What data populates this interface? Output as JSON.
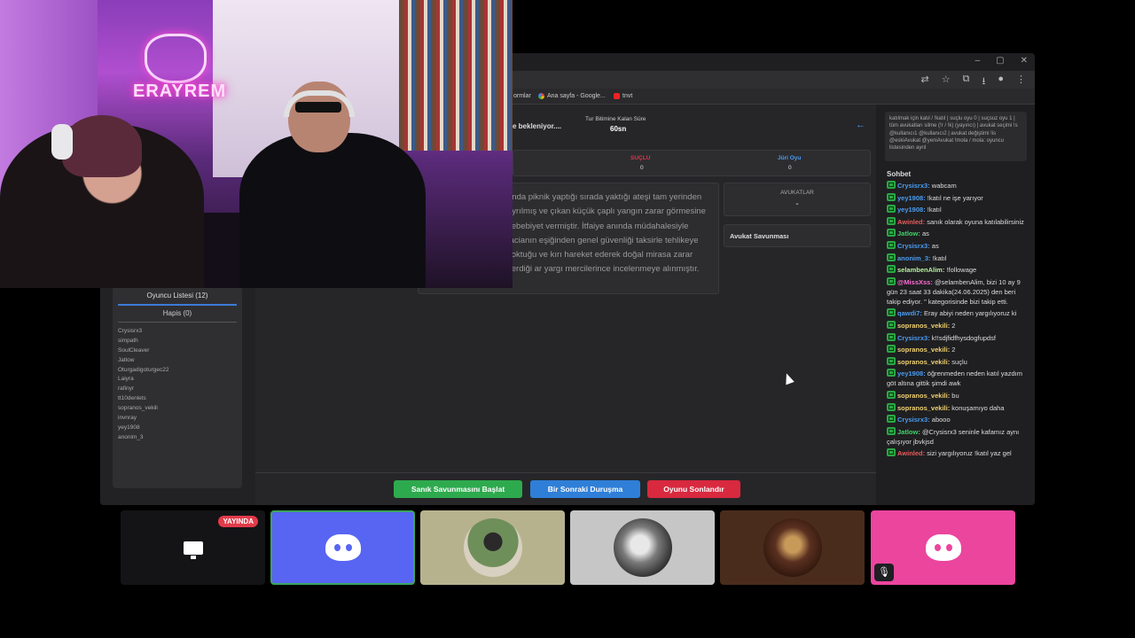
{
  "browser": {
    "window_controls": [
      "–",
      "▢",
      "✕"
    ],
    "bookmarks": [
      {
        "label": "ormlar"
      },
      {
        "label": "Ana sayfa - Google..."
      },
      {
        "label": "tnvt"
      }
    ]
  },
  "game": {
    "waiting": "e bekleniyor....",
    "timer_label": "Tur Bitimine Kalan Süre",
    "timer_value": "60sn",
    "votes": [
      {
        "label": "SUÇLU",
        "value": "0",
        "color": "#e0334a"
      },
      {
        "label": "Jüri Oyu",
        "value": "0",
        "color": "#4a9cf0"
      }
    ],
    "case_text": "anda piknik yaptığı sırada yaktığı ateşi tam yerinden ayrılmış ve çıkan küçük çaplı yangın zarar görmesine sebebiyet vermiştir. İtfaiye anında müdahalesiyle facianın eşiğinden genel güvenliği taksirle tehlikeye soktuğu ve kırı hareket ederek doğal mirasa zarar verdiği ar yargı mercilerince incelenmeye alınmıştır.",
    "lawyers_title": "AVUKATLAR",
    "lawyers_value": "-",
    "defense_title": "Avukat Savunması",
    "players_title": "Oyuncu Listesi (12)",
    "hapis": "Hapis (0)",
    "players": [
      "Crysisrx3",
      "simpath",
      "SoulCleaver",
      "Jatlow",
      "Oturgadigoturgec22",
      "Laiyra",
      "rafinyr",
      "tt10denlets",
      "sopranos_vekili",
      "invnray",
      "yey1908",
      "anonim_3"
    ],
    "buttons": [
      {
        "label": "Sanık Savunmasını Başlat",
        "color": "#2eaa4e"
      },
      {
        "label": "Bir Sonraki Duruşma",
        "color": "#2f7fd8"
      },
      {
        "label": "Oyunu Sonlandır",
        "color": "#d8293f"
      }
    ]
  },
  "chat": {
    "commands": "katılmak için katıl / !katıl | suçlu oyu 0 | suçsuz oyu 1 | tüm avukatları silme (!r / !k) (yayıncı) | avukat seçimi !s @kullanıcı1 @kullanıcı2 | avukat değiştimi !is @eskiAvukat @yeniAvukat !mola / mola: oyuncu listesinden ayrıl",
    "title": "Sohbet",
    "messages": [
      {
        "user": "Crysisrx3:",
        "text": "wabcam",
        "color": "#4a9cf0"
      },
      {
        "user": "yey1908:",
        "text": "!katıl ne işe yarıyor",
        "color": "#4a9cf0"
      },
      {
        "user": "yey1908:",
        "text": "!katıl",
        "color": "#4a9cf0"
      },
      {
        "user": "Awinled:",
        "text": "sanık olarak oyuna katılabilirsiniz",
        "color": "#e85a5a"
      },
      {
        "user": "Jatlow:",
        "text": "as",
        "color": "#3fd36a"
      },
      {
        "user": "Crysisrx3:",
        "text": "as",
        "color": "#4a9cf0"
      },
      {
        "user": "anonim_3:",
        "text": "!katıl",
        "color": "#4a9cf0"
      },
      {
        "user": "selambenAlim:",
        "text": "!followage",
        "color": "#b8f0a0"
      },
      {
        "user": "@MissXss:",
        "text": "@selambenAlim, bizi 10 ay 9 gün 23 saat 33 dakika(24.06.2025) den beri takip ediyor. \" kategorisinde bizi takip etti.",
        "color": "#ff6ad5"
      },
      {
        "user": "qawdi7:",
        "text": "Eray abiyi neden yargılıyoruz ki",
        "color": "#4a9cf0"
      },
      {
        "user": "sopranos_vekili:",
        "text": "2",
        "color": "#f0d070"
      },
      {
        "user": "Crysisrx3:",
        "text": "k!!sdjfidfhysdogfupdsf",
        "color": "#4a9cf0"
      },
      {
        "user": "sopranos_vekili:",
        "text": "2",
        "color": "#f0d070"
      },
      {
        "user": "sopranos_vekili:",
        "text": "suçlu",
        "color": "#f0d070"
      },
      {
        "user": "yey1908:",
        "text": "öğrenmeden neden katıl yazdım göt altına gittik şimdi awk",
        "color": "#4a9cf0"
      },
      {
        "user": "sopranos_vekili:",
        "text": "bu",
        "color": "#f0d070"
      },
      {
        "user": "sopranos_vekili:",
        "text": "konuşamıyo daha",
        "color": "#f0d070"
      },
      {
        "user": "Crysisrx3:",
        "text": "abooo",
        "color": "#4a9cf0"
      },
      {
        "user": "Jatlow:",
        "text": "@Crysisrx3 seninle kafamız aynı çalışıyor jbvkjsd",
        "color": "#3fd36a"
      },
      {
        "user": "Awinled:",
        "text": "sizi yargılıyoruz !katıl yaz gel",
        "color": "#e85a5a"
      }
    ]
  },
  "webcam": {
    "neon_text": "ERAYREM"
  },
  "discord": {
    "live_label": "YAYINDA",
    "tiles": [
      {
        "name": "screen-share",
        "bg": "#141416"
      },
      {
        "name": "discord-default-1",
        "bg": "#5865f2"
      },
      {
        "name": "avatar-1",
        "bg": "#b7b28e"
      },
      {
        "name": "avatar-2",
        "bg": "#c6c6c6"
      },
      {
        "name": "avatar-3",
        "bg": "#4a2c1c"
      },
      {
        "name": "discord-default-2",
        "bg": "#eb459e"
      }
    ],
    "mute_glyph": "🎙"
  }
}
